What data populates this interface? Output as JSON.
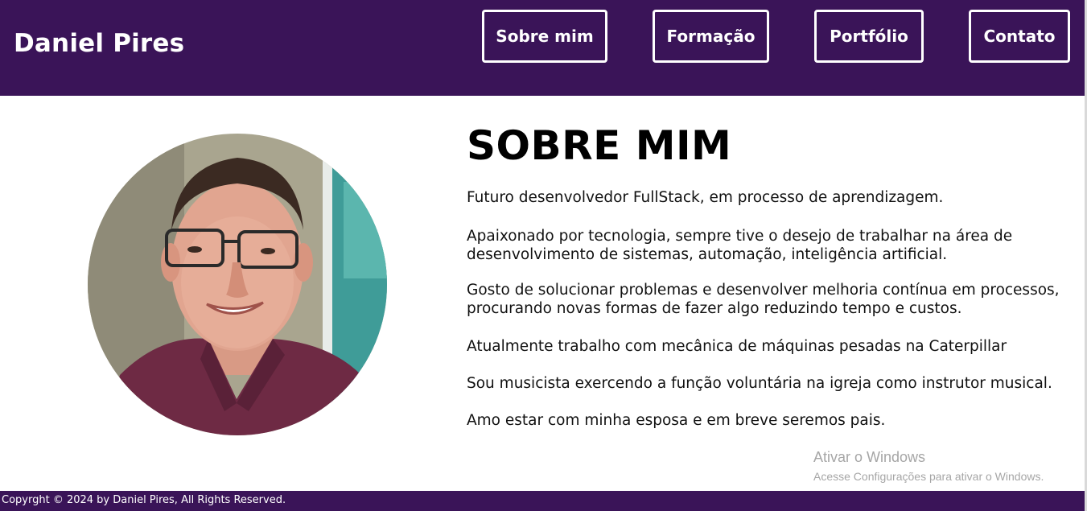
{
  "header": {
    "brand": "Daniel Pires",
    "nav": [
      {
        "label": "Sobre mim"
      },
      {
        "label": "Formação"
      },
      {
        "label": "Portfólio"
      },
      {
        "label": "Contato"
      }
    ]
  },
  "about": {
    "title": "SOBRE MIM",
    "paragraphs": [
      "Futuro desenvolvedor FullStack, em processo de aprendizagem.",
      "Apaixonado por tecnologia, sempre tive o desejo de trabalhar na área de desenvolvimento de sistemas, automação, inteligência artificial.",
      "Gosto de solucionar problemas e desenvolver melhoria contínua em processos, procurando novas formas de fazer algo reduzindo tempo e custos.",
      "Atualmente trabalho com mecânica de máquinas pesadas na Caterpillar",
      "Sou musicista exercendo a função voluntária na igreja como instrutor musical.",
      "Amo estar com minha esposa e em breve seremos pais."
    ]
  },
  "watermark": {
    "title": "Ativar o Windows",
    "subtitle": "Acesse Configurações para ativar o Windows."
  },
  "footer": {
    "text": "Copyrght © 2024 by Daniel Pires, All Rights Reserved."
  },
  "colors": {
    "header_bg": "#3a1458",
    "text": "#111111"
  }
}
